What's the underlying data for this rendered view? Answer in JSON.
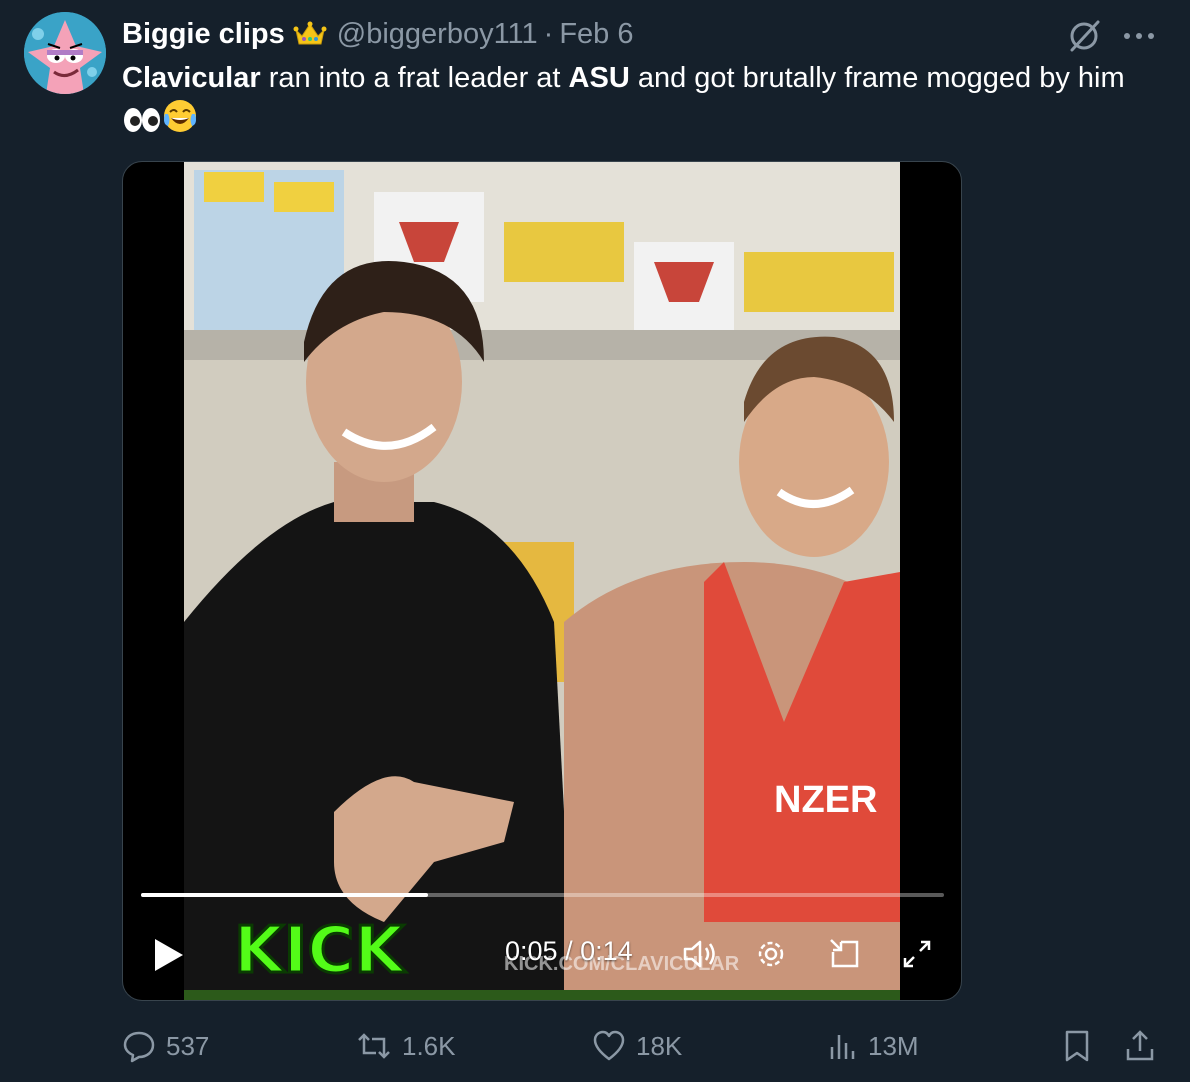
{
  "author": {
    "display_name": "Biggie clips",
    "badge_icon": "crown-icon",
    "handle": "@biggerboy111",
    "date": "Feb 6"
  },
  "tweet": {
    "text_parts": [
      {
        "text": "Clavicular",
        "bold": true
      },
      {
        "text": " ran into a frat leader at ",
        "bold": false
      },
      {
        "text": "ASU",
        "bold": true
      },
      {
        "text": " and got brutally frame mogged by him",
        "bold": false
      }
    ],
    "emojis": [
      "eyes-emoji",
      "tears-of-joy-emoji"
    ]
  },
  "video": {
    "watermark": "KICK",
    "overlay_text": "KICK.COM/CLAVICULAR",
    "tank_print": "NZER",
    "time_current": "0:05",
    "time_separator": " / ",
    "time_total": "0:14",
    "progress_fraction": 0.357
  },
  "actions": {
    "replies": "537",
    "retweets": "1.6K",
    "likes": "18K",
    "views": "13M"
  },
  "colors": {
    "background": "#15202b",
    "secondary_text": "#8b98a5",
    "border": "#38444d",
    "kick_green": "#53fc18"
  }
}
